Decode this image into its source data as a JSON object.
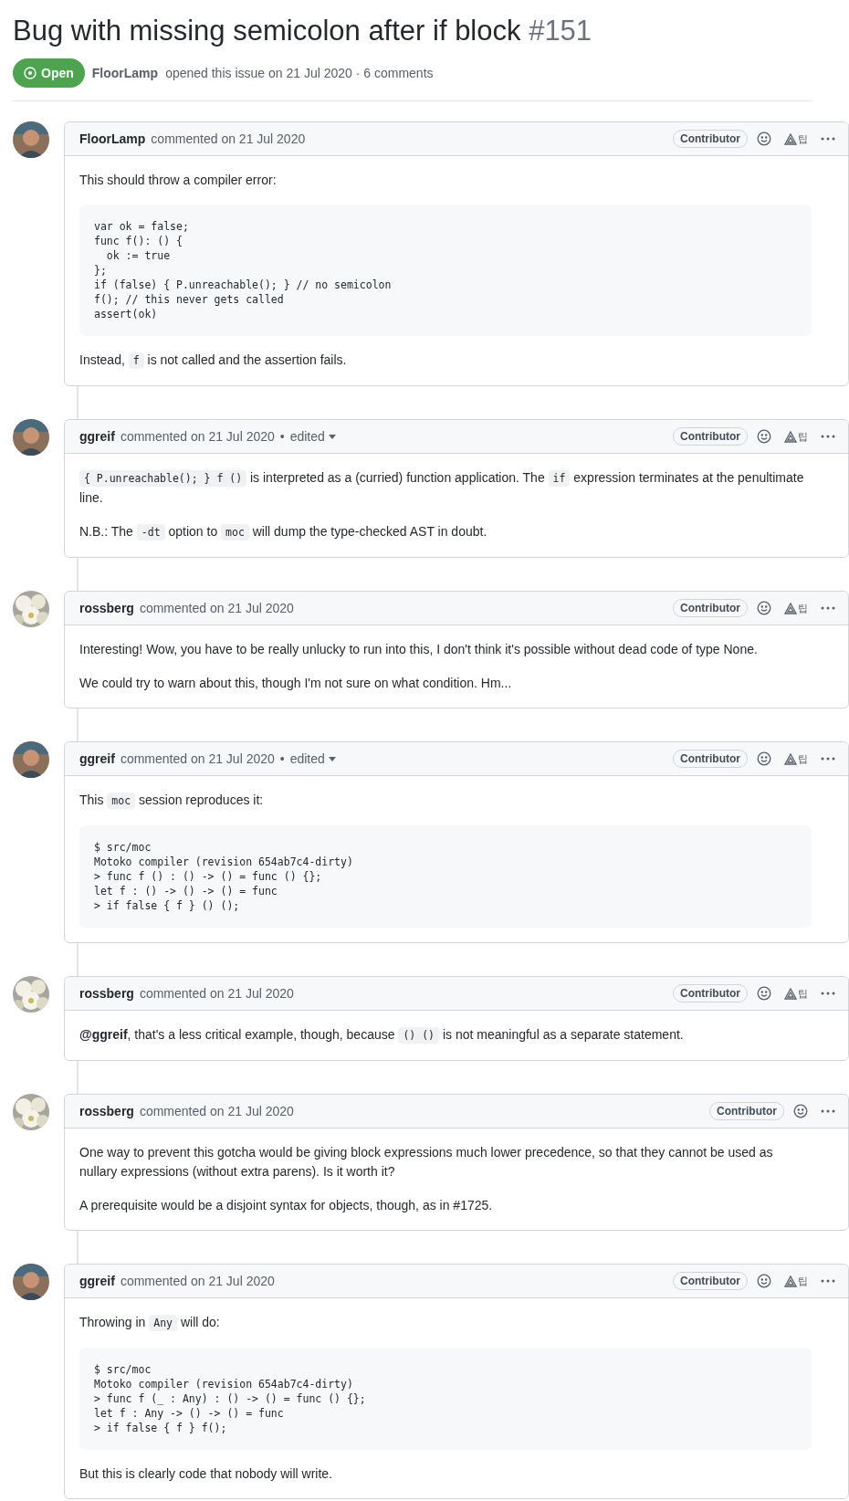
{
  "issue": {
    "title": "Bug with missing semicolon after if block",
    "number": "#151",
    "state": {
      "label": "Open",
      "kind": "open"
    },
    "author": "FloorLamp",
    "meta": "opened this issue on 21 Jul 2020 · 6 comments"
  },
  "comments": [
    {
      "author": "FloorLamp",
      "kind": "person",
      "meta": "commented on 21 Jul 2020",
      "badge": "Contributor",
      "tip": "팁",
      "body": [
        {
          "kind": "p",
          "segments": [
            {
              "kind": "text",
              "text": "This should throw a compiler error:"
            }
          ]
        },
        {
          "kind": "code",
          "lines": [
            "var ok = false;",
            "func f(): () {",
            "  ok := true",
            "};",
            "if (false) { P.unreachable(); } // no semicolon",
            "f(); // this never gets called",
            "assert(ok)"
          ]
        },
        {
          "kind": "p",
          "segments": [
            {
              "kind": "text",
              "text": "Instead, "
            },
            {
              "kind": "code",
              "text": "f"
            },
            {
              "kind": "text",
              "text": " is not called and the assertion fails."
            }
          ]
        }
      ]
    },
    {
      "author": "ggreif",
      "kind": "person",
      "meta": "commented on 21 Jul 2020",
      "edited": {
        "separator": "•",
        "label": "edited"
      },
      "badge": "Contributor",
      "tip": "팁",
      "body": [
        {
          "kind": "p",
          "segments": [
            {
              "kind": "code",
              "text": "{ P.unreachable(); } f ()"
            },
            {
              "kind": "text",
              "text": " is interpreted as a (curried) function application. The "
            },
            {
              "kind": "code",
              "text": "if"
            },
            {
              "kind": "text",
              "text": " expression terminates at the penultimate line."
            }
          ]
        },
        {
          "kind": "p",
          "segments": [
            {
              "kind": "text",
              "text": "N.B.: The "
            },
            {
              "kind": "code",
              "text": "-dt"
            },
            {
              "kind": "text",
              "text": " option to "
            },
            {
              "kind": "code",
              "text": "moc"
            },
            {
              "kind": "text",
              "text": " will dump the type-checked AST in doubt."
            }
          ]
        }
      ]
    },
    {
      "author": "rossberg",
      "kind": "flowers",
      "meta": "commented on 21 Jul 2020",
      "badge": "Contributor",
      "tip": "팁",
      "body": [
        {
          "kind": "p",
          "segments": [
            {
              "kind": "text",
              "text": "Interesting! Wow, you have to be really unlucky to run into this, I don't think it's possible without dead code of type None."
            }
          ]
        },
        {
          "kind": "p",
          "segments": [
            {
              "kind": "text",
              "text": "We could try to warn about this, though I'm not sure on what condition. Hm..."
            }
          ]
        }
      ]
    },
    {
      "author": "ggreif",
      "kind": "person",
      "meta": "commented on 21 Jul 2020",
      "edited": {
        "separator": "•",
        "label": "edited"
      },
      "badge": "Contributor",
      "tip": "팁",
      "body": [
        {
          "kind": "p",
          "segments": [
            {
              "kind": "text",
              "text": "This "
            },
            {
              "kind": "code",
              "text": "moc"
            },
            {
              "kind": "text",
              "text": " session reproduces it:"
            }
          ]
        },
        {
          "kind": "code",
          "lines": [
            "$ src/moc",
            "Motoko compiler (revision 654ab7c4-dirty)",
            "> func f () : () -> () = func () {};",
            "let f : () -> () -> () = func",
            "> if false { f } () ();"
          ]
        }
      ]
    },
    {
      "author": "rossberg",
      "kind": "flowers",
      "meta": "commented on 21 Jul 2020",
      "badge": "Contributor",
      "tip": "팁",
      "body": [
        {
          "kind": "p",
          "segments": [
            {
              "kind": "text",
              "text": "**@ggreif**, that's a less critical example, though, because "
            },
            {
              "kind": "code",
              "text": "() ()"
            },
            {
              "kind": "text",
              "text": " is not meaningful as a separate statement."
            }
          ]
        }
      ]
    },
    {
      "author": "rossberg",
      "kind": "flowers",
      "meta": "commented on 21 Jul 2020",
      "badge": "Contributor",
      "body": [
        {
          "kind": "p",
          "segments": [
            {
              "kind": "text",
              "text": "One way to prevent this gotcha would be giving block expressions much lower precedence, so that they cannot be used as nullary expressions (without extra parens). Is it worth it?"
            }
          ]
        },
        {
          "kind": "p",
          "segments": [
            {
              "kind": "text",
              "text": "A prerequisite would be a disjoint syntax for objects, though, as in #1725."
            }
          ]
        }
      ]
    },
    {
      "author": "ggreif",
      "kind": "person",
      "meta": "commented on 21 Jul 2020",
      "badge": "Contributor",
      "tip": "팁",
      "body": [
        {
          "kind": "p",
          "segments": [
            {
              "kind": "text",
              "text": "Throwing in "
            },
            {
              "kind": "code",
              "text": "Any"
            },
            {
              "kind": "text",
              "text": " will do:"
            }
          ]
        },
        {
          "kind": "code",
          "lines": [
            "$ src/moc",
            "Motoko compiler (revision 654ab7c4-dirty)",
            "> func f (_ : Any) : () -> () = func () {};",
            "let f : Any -> () -> () = func",
            "> if false { f } f();"
          ]
        },
        {
          "kind": "p",
          "segments": [
            {
              "kind": "text",
              "text": "But this is clearly code that nobody will write."
            }
          ]
        }
      ]
    }
  ]
}
